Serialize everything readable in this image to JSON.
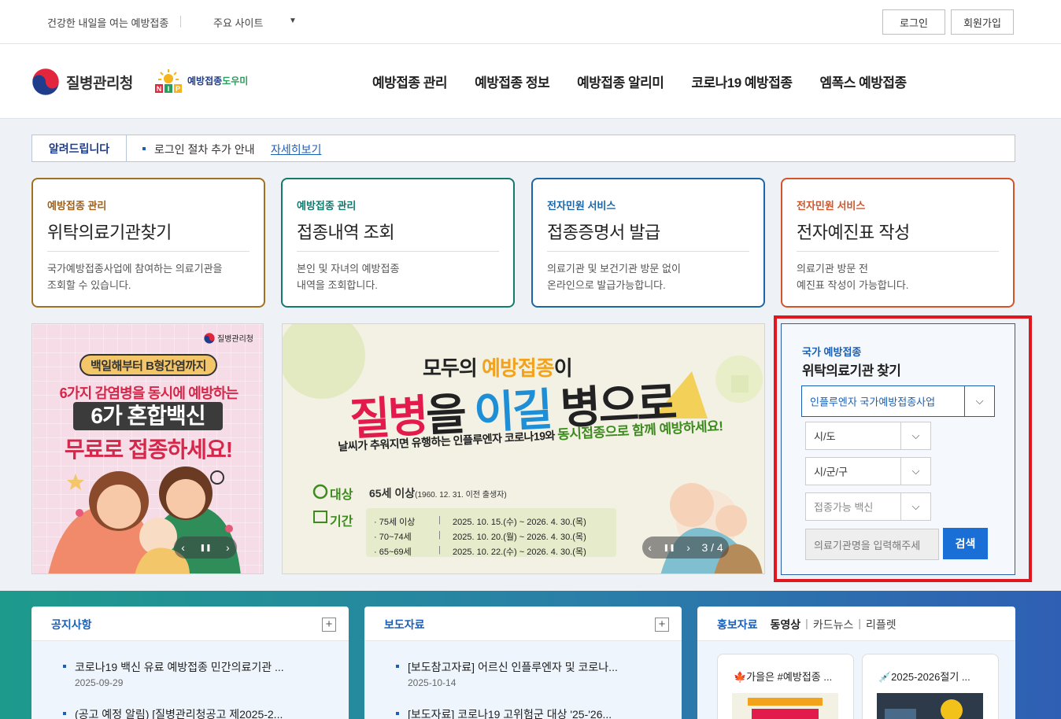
{
  "topbar": {
    "slogan": "건강한 내일을 여는 예방접종",
    "sites": "주요 사이트",
    "sites_caret": "▼",
    "login": "로그인",
    "join": "회원가입"
  },
  "header": {
    "agency": "질병관리청",
    "nip_name_a": "예방접종",
    "nip_name_b": "도우미",
    "nav": [
      "예방접종 관리",
      "예방접종 정보",
      "예방접종 알리미",
      "코로나19 예방접종",
      "엠폭스 예방접종"
    ]
  },
  "notice": {
    "label": "알려드립니다",
    "text": "로그인 절차 추가 안내",
    "more": "자세히보기"
  },
  "cards": [
    {
      "category": "예방접종 관리",
      "title": "위탁의료기관찾기",
      "desc1": "국가예방접종사업에 참여하는 의료기관을",
      "desc2": "조회할 수 있습니다."
    },
    {
      "category": "예방접종 관리",
      "title": "접종내역 조회",
      "desc1": "본인 및 자녀의 예방접종",
      "desc2": "내역을 조회합니다."
    },
    {
      "category": "전자민원 서비스",
      "title": "접종증명서 발급",
      "desc1": "의료기관 및 보건기관 방문 없이",
      "desc2": "온라인으로 발급가능합니다."
    },
    {
      "category": "전자민원 서비스",
      "title": "전자예진표 작성",
      "desc1": "의료기관 방문 전",
      "desc2": "예진표 작성이 가능합니다."
    }
  ],
  "banner1": {
    "brand": "질병관리청",
    "pill": "백일해부터 B형간염까지",
    "line1": "6가지 감염병을 동시에 예방하는",
    "line2": "6가 혼합백신",
    "line3": "무료로 접종하세요!",
    "prev": "‹",
    "pause": "❚❚",
    "next": "›"
  },
  "banner2": {
    "top_a": "모두의",
    "top_b": "예방접종",
    "top_c": "이",
    "main_a": "질병",
    "main_b": "을 ",
    "main_c": "이길",
    "main_d": " 병으로",
    "sub_a": "날씨가 추워지면 유행하는 인플루엔자 코로나19와 ",
    "sub_b": "동시접종",
    "sub_c": "으로 함께 예방하세요!",
    "target_label": "대상",
    "target_value": "65세 이상",
    "target_note": "(1960. 12. 31. 이전 출생자)",
    "period_label": "기간",
    "rows": [
      {
        "age": "· 75세 이상",
        "sep": "|",
        "period": "2025. 10. 15.(수) ~ 2026. 4. 30.(목)"
      },
      {
        "age": "· 70~74세",
        "sep": "|",
        "period": "2025. 10. 20.(월) ~ 2026. 4. 30.(목)"
      },
      {
        "age": "· 65~69세",
        "sep": "|",
        "period": "2025. 10. 22.(수) ~ 2026. 4. 30.(목)"
      }
    ],
    "prev": "‹",
    "pause": "❚❚",
    "next": "›",
    "counter": "3 / 4"
  },
  "search": {
    "subtitle": "국가 예방접종",
    "title": "위탁의료기관 찾기",
    "program": "인플루엔자 국가예방접종사업",
    "sido": "시/도",
    "sigungu": "시/군/구",
    "vaccine": "접종가능 백신",
    "placeholder": "의료기관명을 입력해주세",
    "button": "검색",
    "arrow": "⌵"
  },
  "panels": {
    "notice": {
      "title": "공지사항",
      "plus": "+",
      "items": [
        {
          "title": "코로나19 백신 유료 예방접종 민간의료기관 ...",
          "date": "2025-09-29"
        },
        {
          "title": "(공고 예정 알림) [질병관리청공고 제2025-2...",
          "date": ""
        }
      ]
    },
    "press": {
      "title": "보도자료",
      "plus": "+",
      "items": [
        {
          "title": "[보도참고자료] 어르신 인플루엔자 및 코로나...",
          "date": "2025-10-14"
        },
        {
          "title": "[보도자료] 코로나19 고위험군 대상 '25-'26...",
          "date": ""
        }
      ]
    },
    "promo": {
      "tab_main": "홍보자료",
      "tabs": [
        "동영상",
        "카드뉴스",
        "리플렛"
      ],
      "bar": "|",
      "thumbs": [
        "🍁가을은 #예방접종 ...",
        "💉2025-2026절기 ..."
      ]
    }
  }
}
